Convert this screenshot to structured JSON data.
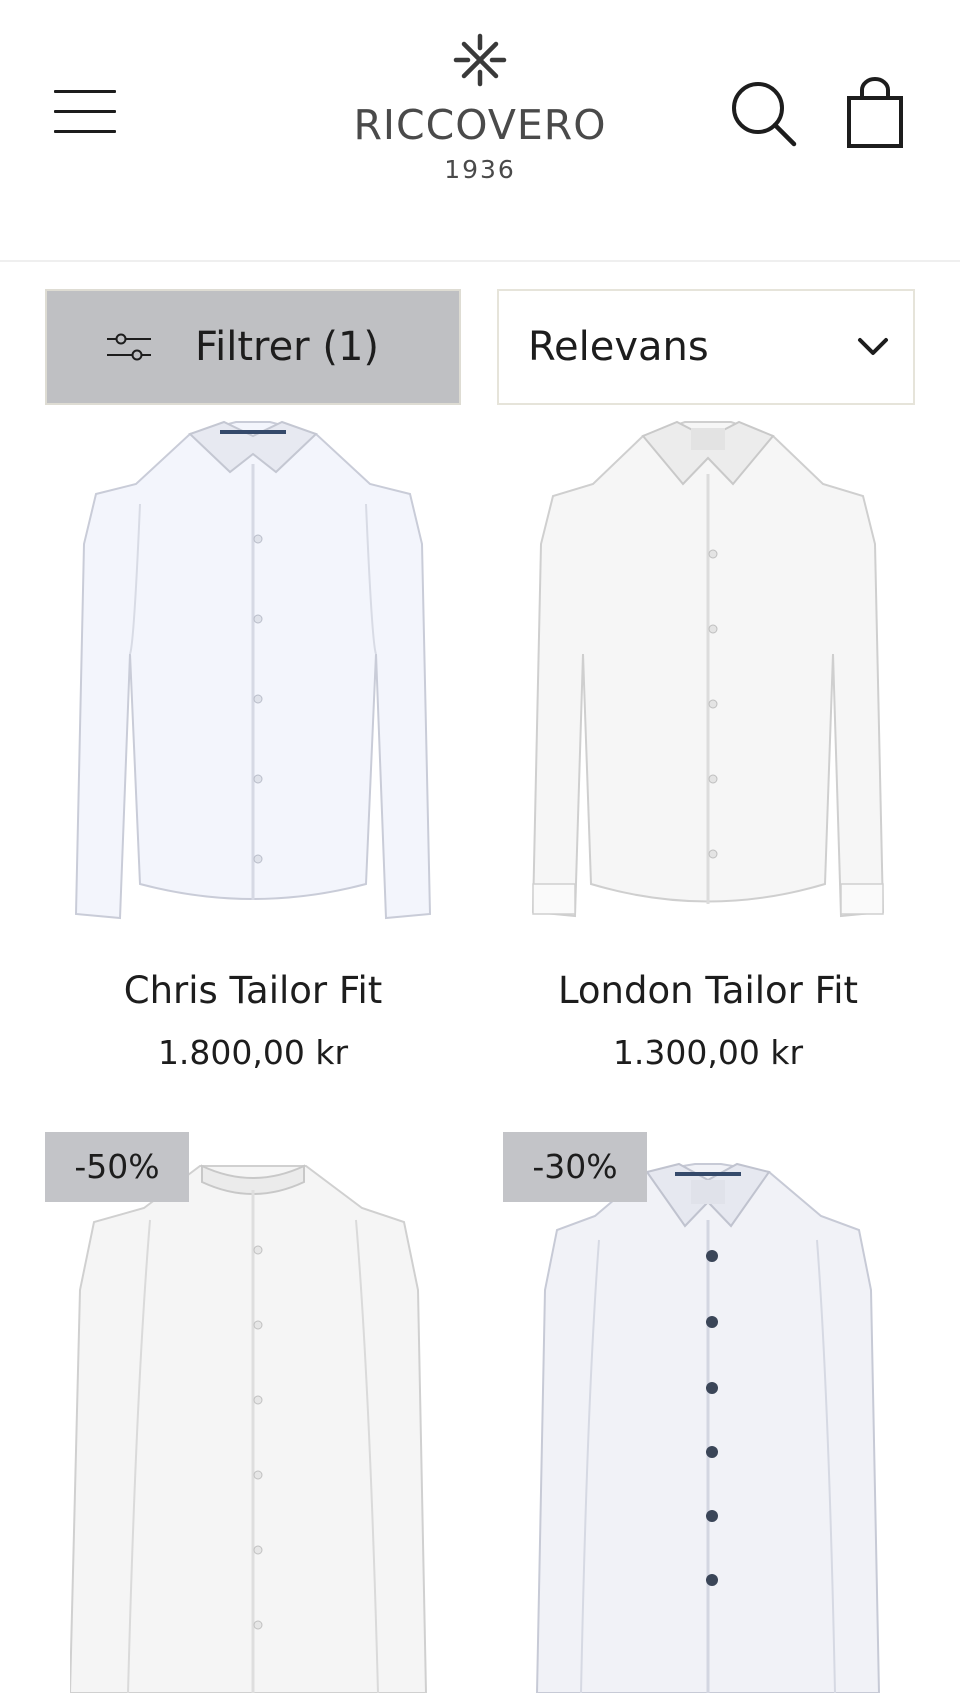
{
  "header": {
    "menu_label": "Menu",
    "logo": {
      "name": "RICCOVERO",
      "year": "1936"
    },
    "search_icon": "search-icon",
    "cart_icon": "shopping-bag-icon"
  },
  "toolbar": {
    "filter_label": "Filtrer (1)",
    "sort_selected": "Relevans"
  },
  "products": [
    {
      "name": "Chris Tailor Fit",
      "price": "1.800,00 kr",
      "badge": "",
      "shirt_tint": "#eef0f8"
    },
    {
      "name": "London Tailor Fit",
      "price": "1.300,00 kr",
      "badge": "",
      "shirt_tint": "#f3f3f3"
    },
    {
      "name": "",
      "price": "",
      "badge": "-50%",
      "shirt_tint": "#f1f1f1"
    },
    {
      "name": "",
      "price": "",
      "badge": "-30%",
      "shirt_tint": "#eeeff4"
    }
  ],
  "colors": {
    "filter_bg": "#bfc0c3",
    "badge_bg": "#c3c4c8",
    "text": "#1d1d1d",
    "logo_text": "#4a4a4a"
  }
}
